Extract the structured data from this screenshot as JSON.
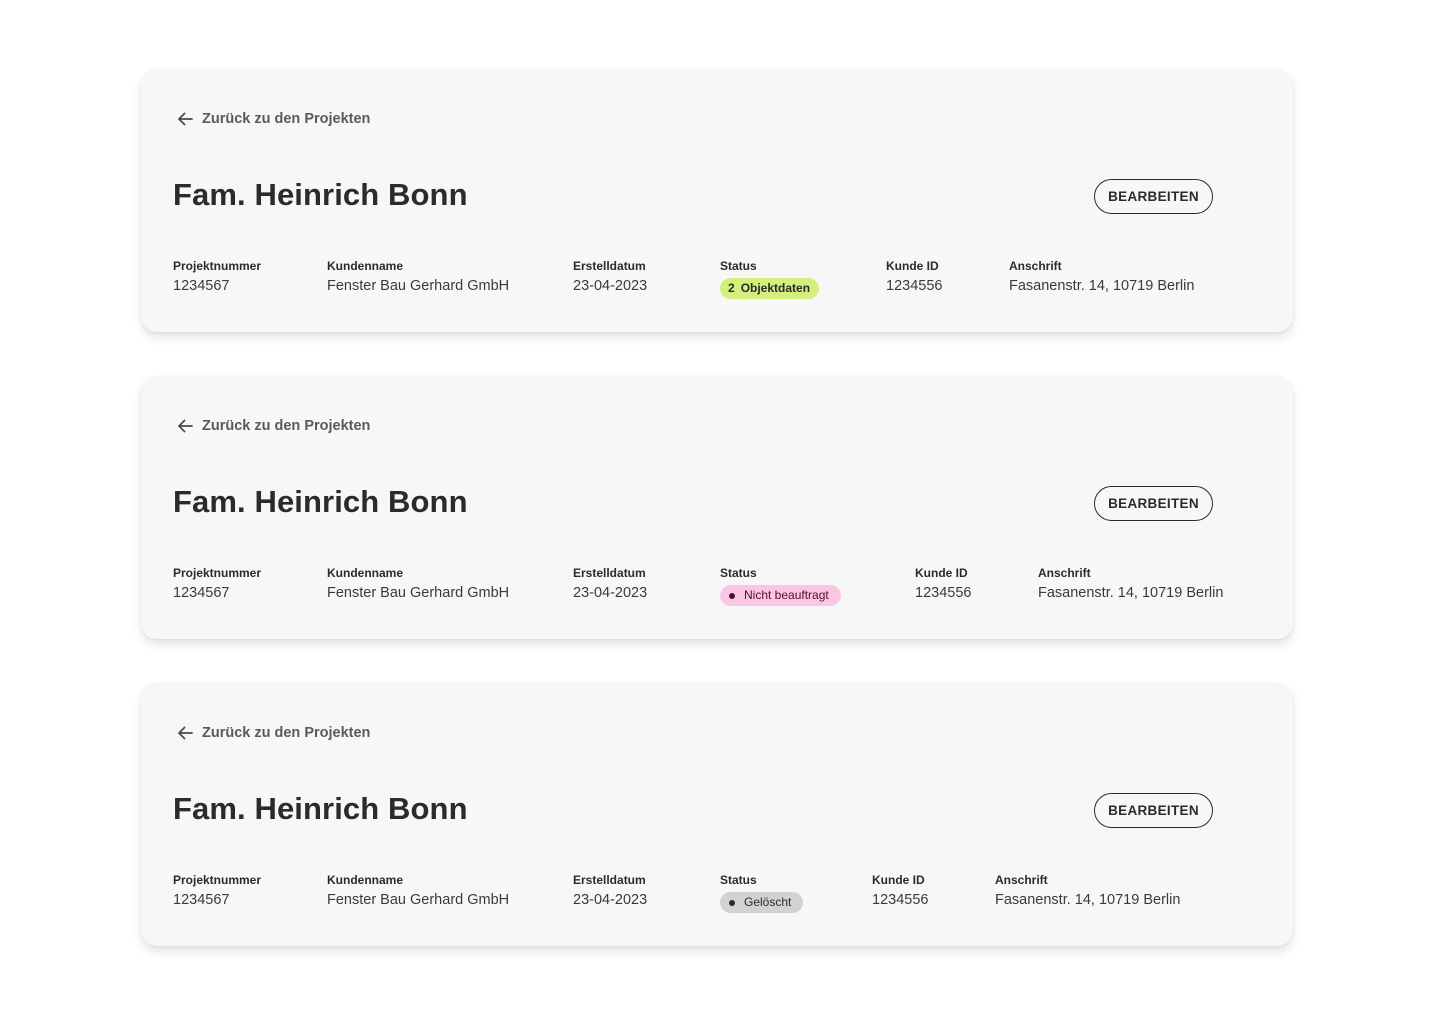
{
  "cards": [
    {
      "back_link": "Zurück zu den Projekten",
      "title": "Fam. Heinrich Bonn",
      "edit_label": "BEARBEITEN",
      "fields": {
        "projektnummer": {
          "label": "Projektnummer",
          "value": "1234567"
        },
        "kundenname": {
          "label": "Kundenname",
          "value": "Fenster Bau Gerhard GmbH"
        },
        "erstelldatum": {
          "label": "Erstelldatum",
          "value": "23-04-2023"
        },
        "status": {
          "label": "Status",
          "count": "2",
          "text": "Objektdaten",
          "color": "#d3ef7c"
        },
        "kunde_id": {
          "label": "Kunde ID",
          "value": "1234556"
        },
        "anschrift": {
          "label": "Anschrift",
          "value": "Fasanenstr. 14, 10719 Berlin"
        }
      }
    },
    {
      "back_link": "Zurück zu den Projekten",
      "title": "Fam. Heinrich Bonn",
      "edit_label": "BEARBEITEN",
      "fields": {
        "projektnummer": {
          "label": "Projektnummer",
          "value": "1234567"
        },
        "kundenname": {
          "label": "Kundenname",
          "value": "Fenster Bau Gerhard GmbH"
        },
        "erstelldatum": {
          "label": "Erstelldatum",
          "value": "23-04-2023"
        },
        "status": {
          "label": "Status",
          "text": "Nicht beauftragt",
          "color": "#fbc6e6"
        },
        "kunde_id": {
          "label": "Kunde ID",
          "value": "1234556"
        },
        "anschrift": {
          "label": "Anschrift",
          "value": "Fasanenstr. 14, 10719 Berlin"
        }
      }
    },
    {
      "back_link": "Zurück zu den Projekten",
      "title": "Fam. Heinrich Bonn",
      "edit_label": "BEARBEITEN",
      "fields": {
        "projektnummer": {
          "label": "Projektnummer",
          "value": "1234567"
        },
        "kundenname": {
          "label": "Kundenname",
          "value": "Fenster Bau Gerhard GmbH"
        },
        "erstelldatum": {
          "label": "Erstelldatum",
          "value": "23-04-2023"
        },
        "status": {
          "label": "Status",
          "text": "Gelöscht",
          "color": "#d2d2d2"
        },
        "kunde_id": {
          "label": "Kunde ID",
          "value": "1234556"
        },
        "anschrift": {
          "label": "Anschrift",
          "value": "Fasanenstr. 14, 10719 Berlin"
        }
      }
    }
  ]
}
